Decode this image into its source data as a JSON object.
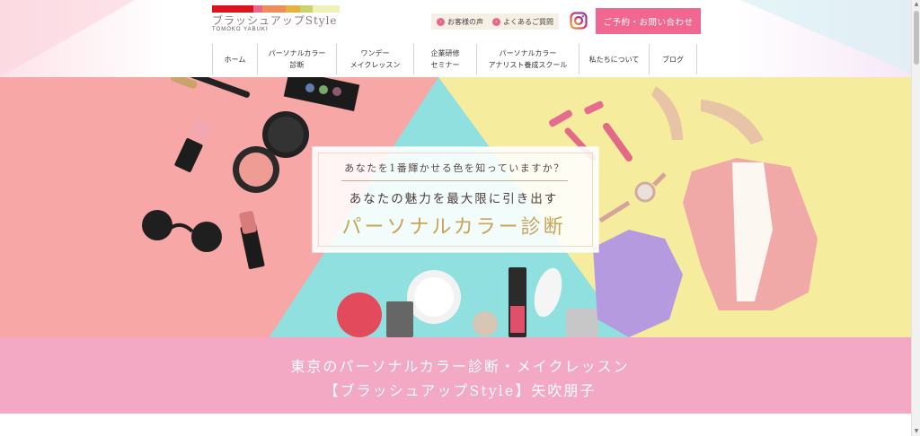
{
  "header": {
    "logo": {
      "title": "ブラッシュアップStyle",
      "subtitle": "TOMOKO YABUKI",
      "bar_colors": [
        "#d9141c",
        "#e8668a",
        "#f08c5a",
        "#e7b13c",
        "#c9d36b",
        "#eef0b8"
      ]
    },
    "util_links": [
      {
        "label": "お客様の声",
        "icon": "chevron-right-icon"
      },
      {
        "label": "よくあるご質問",
        "icon": "chevron-right-icon"
      }
    ],
    "instagram_icon": "instagram-icon",
    "cta_label": "ご予約・お問い合わせ"
  },
  "nav": {
    "items": [
      {
        "label": "ホーム"
      },
      {
        "label": "パーソナルカラー\n診断"
      },
      {
        "label": "ワンデー\nメイクレッスン"
      },
      {
        "label": "企業研修\nセミナー"
      },
      {
        "label": "パーソナルカラー\nアナリスト養成スクール"
      },
      {
        "label": "私たちについて"
      },
      {
        "label": "ブログ"
      }
    ]
  },
  "hero": {
    "question": "あなたを1番輝かせる色を知っていますか？",
    "subtitle": "あなたの魅力を最大限に引き出す",
    "title": "パーソナルカラー診断",
    "colors": {
      "pink": "#f7a8a6",
      "yellow": "#f6ec9e",
      "mint": "#8fe0df",
      "gold": "#c8a35a"
    }
  },
  "band": {
    "line1": "東京のパーソナルカラー診断・メイクレッスン",
    "line2": "【ブラッシュアップStyle】矢吹朋子"
  }
}
